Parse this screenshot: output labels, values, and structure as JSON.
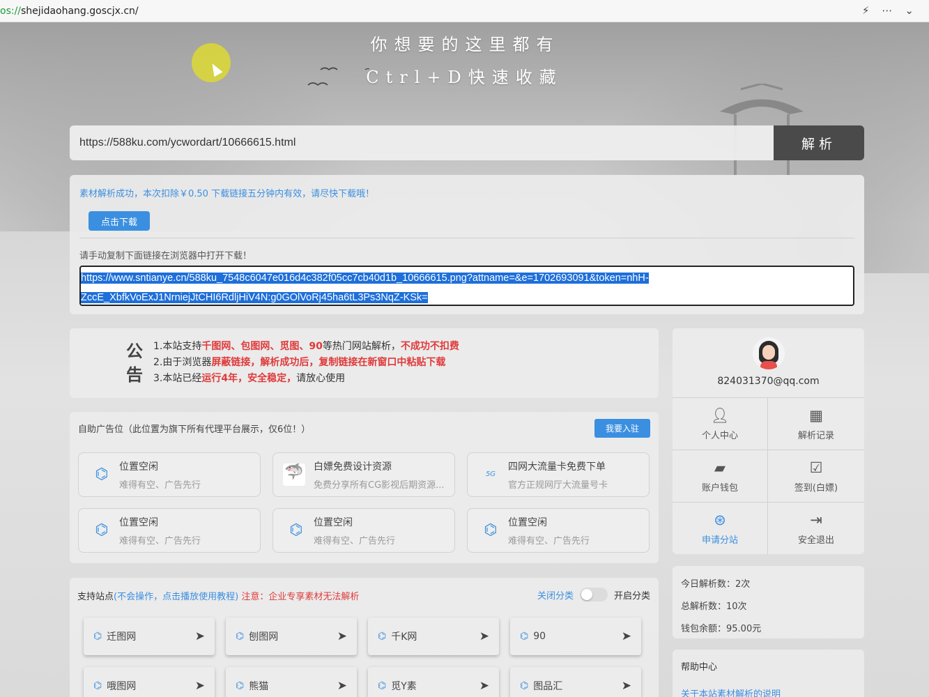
{
  "browser": {
    "url_scheme": "os://",
    "url_rest": "shejidaohang.goscjx.cn/",
    "icons": [
      "lightning-icon",
      "more-icon",
      "chevron-down-icon"
    ]
  },
  "hero": {
    "line1": "你想要的这里都有",
    "line2": "Ctrl+D快速收藏"
  },
  "search": {
    "value": "https://588ku.com/ycwordart/10666615.html",
    "button": "解析"
  },
  "result": {
    "success_msg": "素材解析成功，本次扣除￥0.50 下载链接五分钟内有效，请尽快下载哦！",
    "download_btn": "点击下载",
    "copy_tip": "请手动复制下面链接在浏览器中打开下载！",
    "link_line1": "https://www.sntianye.cn/588ku_7548c6047e016d4c382f05cc7cb40d1b_10666615.png?attname=&e=1702693091&token=nhH-",
    "link_line2": "ZccE_XbfkVoExJ1NrniejJtCHI6RdljHiV4N:g0GOlVoRj45ha6tL3Ps3NqZ-KSk="
  },
  "notice": {
    "title_1": "公",
    "title_2": "告",
    "l1_a": "1.本站支持",
    "l1_b": "千图网、包图网、觅图、90",
    "l1_c": "等热门网站解析，",
    "l1_d": "不成功不扣费",
    "l2_a": "2.由于浏览器",
    "l2_b": "屏蔽链接，解析成功后，复制链接在新窗口中粘贴下载",
    "l3_a": "3.本站已经",
    "l3_b": "运行4年，安全稳定，",
    "l3_c": "请放心使用"
  },
  "ads": {
    "heading": "自助广告位（此位置为旗下所有代理平台展示，仅6位！）",
    "join_btn": "我要入驻",
    "cards": [
      {
        "title": "位置空闲",
        "sub": "难得有空、广告先行"
      },
      {
        "title": "白嫖免费设计资源",
        "sub": "免费分享所有CG影视后期资源..."
      },
      {
        "title": "四网大流量卡免费下单",
        "sub": "官方正规网厅大流量号卡"
      },
      {
        "title": "位置空闲",
        "sub": "难得有空、广告先行"
      },
      {
        "title": "位置空闲",
        "sub": "难得有空、广告先行"
      },
      {
        "title": "位置空闲",
        "sub": "难得有空、广告先行"
      }
    ]
  },
  "sites": {
    "label": "支持站点",
    "tutorial": "(不会操作，点击播放使用教程)",
    "warning": "注意：企业专享素材无法解析",
    "close_cat": "关闭分类",
    "open_cat": "开启分类",
    "items": [
      "迁图网",
      "刨图网",
      "千K网",
      "90",
      "哦图网",
      "熊猫",
      "觅Y素",
      "图品汇"
    ]
  },
  "user": {
    "email": "824031370@qq.com",
    "menu": [
      {
        "label": "个人中心",
        "icon": "person-icon"
      },
      {
        "label": "解析记录",
        "icon": "grid-icon"
      },
      {
        "label": "账户钱包",
        "icon": "wallet-icon"
      },
      {
        "label": "签到(白嫖)",
        "icon": "calendar-check-icon"
      },
      {
        "label": "申请分站",
        "icon": "branch-icon"
      },
      {
        "label": "安全退出",
        "icon": "logout-icon"
      }
    ]
  },
  "stats": {
    "today": "今日解析数：2次",
    "total": "总解析数：10次",
    "balance": "钱包余额：95.00元"
  },
  "help": {
    "title": "帮助中心",
    "link": "关于本站素材解析的说明"
  },
  "colors": {
    "accent": "#3b8fe0",
    "warning": "#e03a3a",
    "parse_button": "#4a4a4a"
  }
}
